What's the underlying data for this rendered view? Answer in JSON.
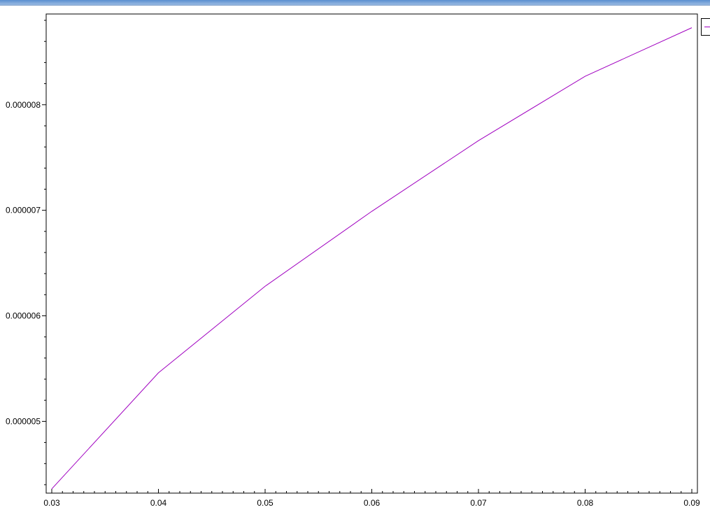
{
  "chart_data": {
    "type": "line",
    "title": "",
    "xlabel": "",
    "ylabel": "",
    "x": [
      0.03,
      0.04,
      0.05,
      0.06,
      0.07,
      0.08,
      0.09
    ],
    "series": [
      {
        "values": [
          4.36e-06,
          5.46e-06,
          6.28e-06,
          6.99e-06,
          7.66e-06,
          8.27e-06,
          8.73e-06
        ],
        "color": "#a000c0"
      }
    ],
    "xlim": [
      0.03,
      0.09
    ],
    "ylim": [
      4.32e-06,
      8.86e-06
    ],
    "x_ticks": [
      "0.03",
      "0.04",
      "0.05",
      "0.06",
      "0.07",
      "0.08",
      "0.09"
    ],
    "y_ticks": [
      "0.000005",
      "0.000006",
      "0.000007",
      "0.000008"
    ],
    "grid": false,
    "legend": "top-right"
  }
}
